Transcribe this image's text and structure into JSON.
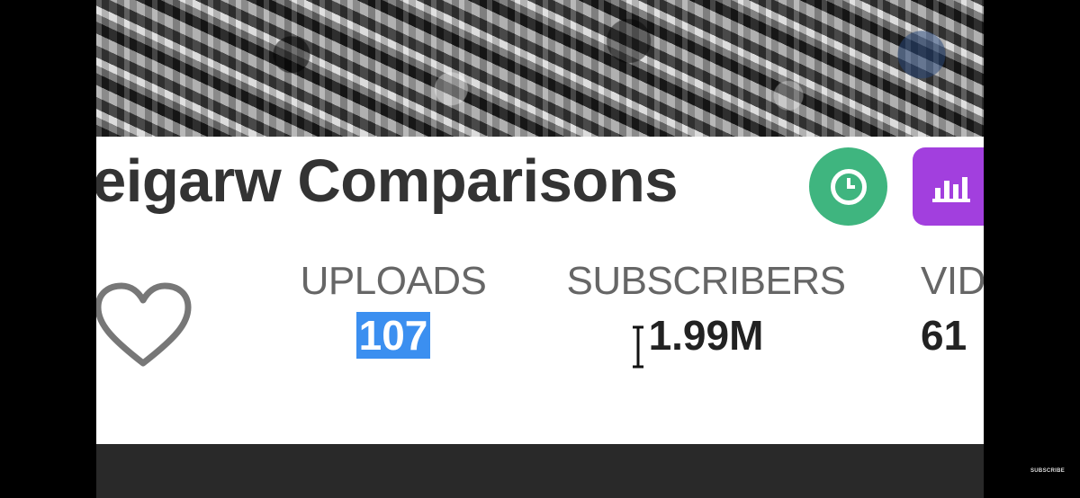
{
  "channel": {
    "name": "eigarw Comparisons"
  },
  "badges": {
    "clock_icon": "clock-icon",
    "stats_icon": "bar-chart-icon",
    "clock_color": "#3fb57f",
    "stats_color": "#a23fde"
  },
  "stats": {
    "uploads": {
      "label": "UPLOADS",
      "value": "107"
    },
    "subscribers": {
      "label": "SUBSCRIBERS",
      "value": "1.99M"
    },
    "videos": {
      "label": "VID",
      "value": "61"
    }
  },
  "overlay": {
    "subscribe": "SUBSCRIBE"
  },
  "colors": {
    "selection": "#3b8ff0",
    "text": "#333333"
  }
}
